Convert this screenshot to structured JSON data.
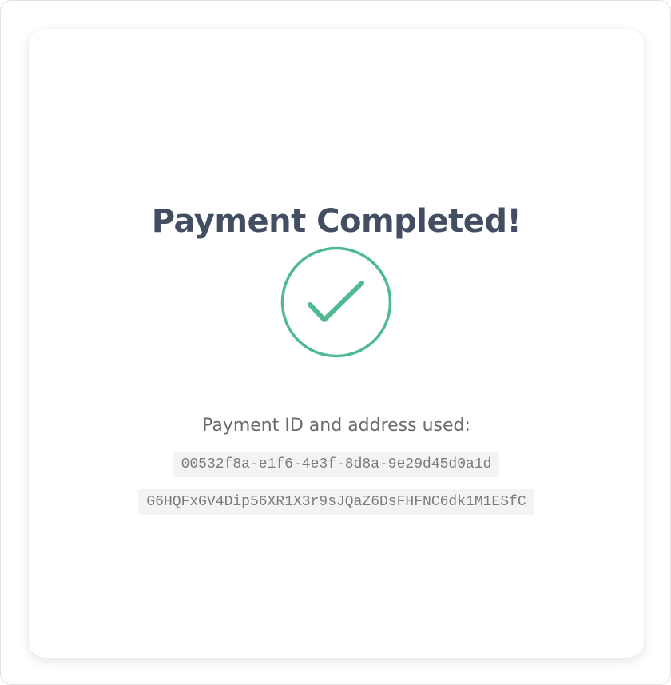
{
  "title": "Payment Completed!",
  "status_icon": "check-circle-icon",
  "colors": {
    "success": "#4fba92",
    "title": "#434e62",
    "label": "#6a6a6a",
    "code_bg": "#f3f3f3"
  },
  "details": {
    "label": "Payment ID and address used:",
    "payment_id": "00532f8a-e1f6-4e3f-8d8a-9e29d45d0a1d",
    "address": "G6HQFxGV4Dip56XR1X3r9sJQaZ6DsFHFNC6dk1M1ESfC"
  }
}
